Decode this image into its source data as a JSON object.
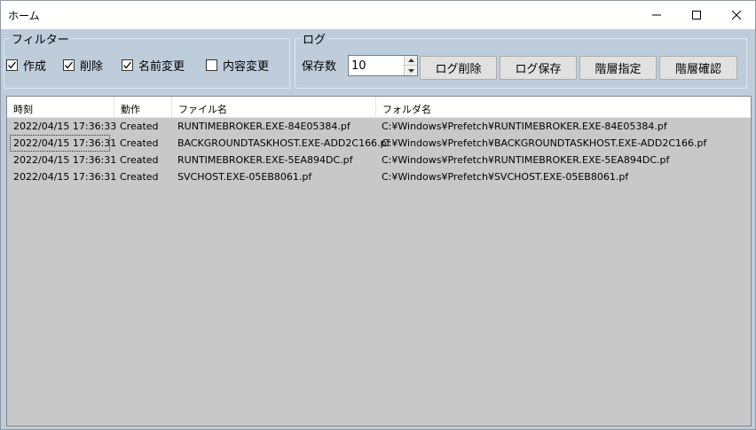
{
  "window": {
    "title": "ホーム"
  },
  "filter": {
    "group_title": "フィルター",
    "items": [
      {
        "label": "作成",
        "checked": true
      },
      {
        "label": "削除",
        "checked": true
      },
      {
        "label": "名前変更",
        "checked": true
      },
      {
        "label": "内容変更",
        "checked": false
      }
    ]
  },
  "log": {
    "group_title": "ログ",
    "keep_label": "保存数",
    "keep_value": "10",
    "buttons": [
      "ログ削除",
      "ログ保存",
      "階層指定",
      "階層確認"
    ]
  },
  "table": {
    "columns": [
      "時刻",
      "動作",
      "ファイル名",
      "フォルダ名"
    ],
    "rows": [
      [
        "2022/04/15 17:36:33",
        "Created",
        "RUNTIMEBROKER.EXE-84E05384.pf",
        "C:¥Windows¥Prefetch¥RUNTIMEBROKER.EXE-84E05384.pf"
      ],
      [
        "2022/04/15 17:36:31",
        "Created",
        "BACKGROUNDTASKHOST.EXE-ADD2C166.pf",
        "C:¥Windows¥Prefetch¥BACKGROUNDTASKHOST.EXE-ADD2C166.pf"
      ],
      [
        "2022/04/15 17:36:31",
        "Created",
        "RUNTIMEBROKER.EXE-5EA894DC.pf",
        "C:¥Windows¥Prefetch¥RUNTIMEBROKER.EXE-5EA894DC.pf"
      ],
      [
        "2022/04/15 17:36:31",
        "Created",
        "SVCHOST.EXE-05EB8061.pf",
        "C:¥Windows¥Prefetch¥SVCHOST.EXE-05EB8061.pf"
      ]
    ]
  },
  "colors": {
    "window_bg": "#bfcddb",
    "list_bg": "#c8c8c8",
    "button_bg": "#e1e1e1"
  }
}
